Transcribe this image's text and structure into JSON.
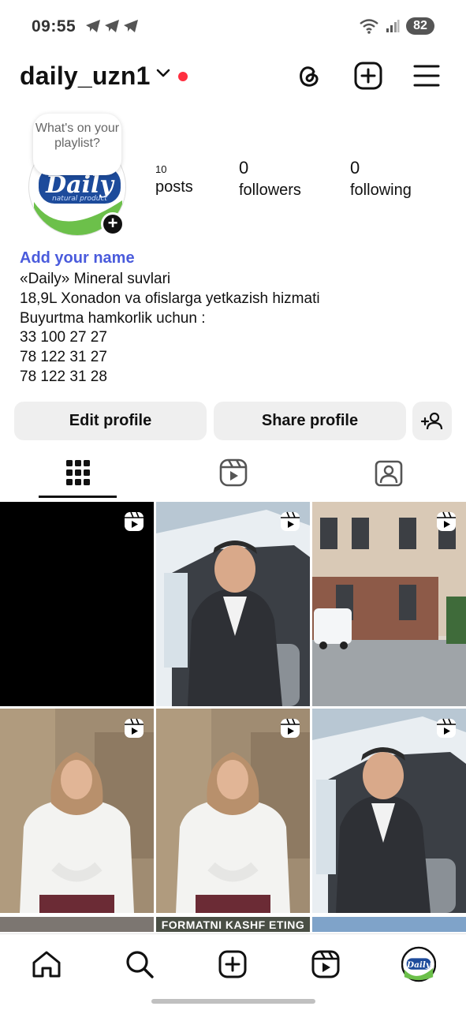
{
  "status_bar": {
    "time": "09:55",
    "battery": "82",
    "icons": [
      "telegram-icon",
      "telegram-icon",
      "telegram-icon",
      "wifi-icon",
      "signal-icon"
    ]
  },
  "header": {
    "username": "daily_uzn1",
    "icons": [
      "chevron-down-icon",
      "threads-icon",
      "create-icon",
      "menu-icon"
    ],
    "accent": "#ff2f40"
  },
  "note": {
    "text": "What's on your playlist?"
  },
  "avatar": {
    "logo": "Daily",
    "tagline": "natural product",
    "brand_blue": "#1d4b9b",
    "brand_green": "#6cc04a"
  },
  "stats": [
    {
      "value": "10",
      "label": "posts"
    },
    {
      "value": "0",
      "label": "followers"
    },
    {
      "value": "0",
      "label": "following"
    }
  ],
  "bio": {
    "add_name": "Add your name",
    "lines": [
      "«Daily» Mineral suvlari",
      "18,9L Xonadon va ofislarga yetkazish hizmati",
      "Buyurtma hamkorlik uchun :",
      "33 100 27 27",
      "78 122 31 27",
      "78 122 31 28"
    ]
  },
  "buttons": {
    "edit": "Edit profile",
    "share": "Share profile",
    "add_person_icon": "add-person-icon"
  },
  "tabs": [
    "grid-icon",
    "reels-icon",
    "tagged-icon"
  ],
  "grid": {
    "strip_text": "FORMATNI KASHF ETING"
  },
  "bottom_nav": [
    "home-icon",
    "search-icon",
    "create-icon",
    "reels-icon",
    "profile-avatar"
  ]
}
